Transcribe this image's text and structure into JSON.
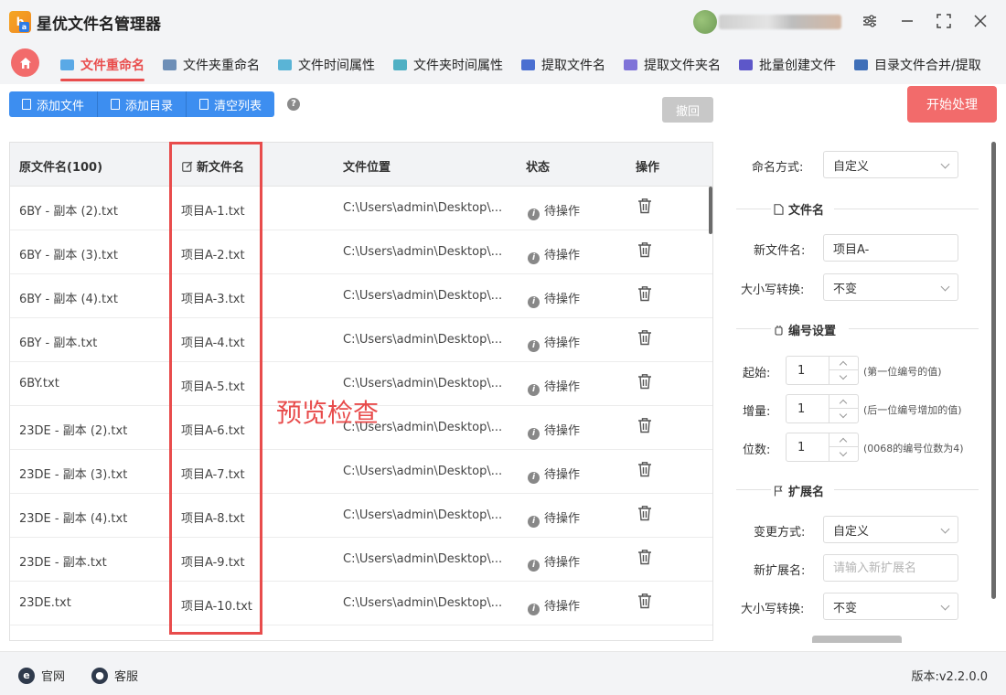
{
  "app": {
    "title": "星优文件名管理器",
    "logo_letter": "b",
    "logo_sub": "a"
  },
  "window_controls": {
    "settings": "⚙",
    "minimize": "—",
    "maximize": "⛶",
    "close": "✕"
  },
  "nav": {
    "tabs": [
      {
        "label": "文件重命名",
        "color": "#5aa9e6"
      },
      {
        "label": "文件夹重命名",
        "color": "#6e8fb7"
      },
      {
        "label": "文件时间属性",
        "color": "#5ab4d6"
      },
      {
        "label": "文件夹时间属性",
        "color": "#4fb0c4"
      },
      {
        "label": "提取文件名",
        "color": "#4a6fd1"
      },
      {
        "label": "提取文件夹名",
        "color": "#7f73d8"
      },
      {
        "label": "批量创建文件",
        "color": "#5d57c9"
      },
      {
        "label": "目录文件合并/提取",
        "color": "#3f6fb8"
      }
    ]
  },
  "toolbar": {
    "add_file": "添加文件",
    "add_dir": "添加目录",
    "clear_list": "清空列表",
    "help": "?",
    "undo": "撤回",
    "start": "开始处理"
  },
  "table": {
    "headers": {
      "original": "原文件名(100)",
      "new_name": "新文件名",
      "location": "文件位置",
      "status": "状态",
      "action": "操作"
    },
    "rows": [
      {
        "original": "6BY - 副本 (2).txt",
        "new_name": "项目A-1.txt",
        "location": "C:\\Users\\admin\\Desktop\\...",
        "status": "待操作"
      },
      {
        "original": "6BY - 副本 (3).txt",
        "new_name": "项目A-2.txt",
        "location": "C:\\Users\\admin\\Desktop\\...",
        "status": "待操作"
      },
      {
        "original": "6BY - 副本 (4).txt",
        "new_name": "项目A-3.txt",
        "location": "C:\\Users\\admin\\Desktop\\...",
        "status": "待操作"
      },
      {
        "original": "6BY - 副本.txt",
        "new_name": "项目A-4.txt",
        "location": "C:\\Users\\admin\\Desktop\\...",
        "status": "待操作"
      },
      {
        "original": "6BY.txt",
        "new_name": "项目A-5.txt",
        "location": "C:\\Users\\admin\\Desktop\\...",
        "status": "待操作"
      },
      {
        "original": "23DE - 副本 (2).txt",
        "new_name": "项目A-6.txt",
        "location": "C:\\Users\\admin\\Desktop\\...",
        "status": "待操作"
      },
      {
        "original": "23DE - 副本 (3).txt",
        "new_name": "项目A-7.txt",
        "location": "C:\\Users\\admin\\Desktop\\...",
        "status": "待操作"
      },
      {
        "original": "23DE - 副本 (4).txt",
        "new_name": "项目A-8.txt",
        "location": "C:\\Users\\admin\\Desktop\\...",
        "status": "待操作"
      },
      {
        "original": "23DE - 副本.txt",
        "new_name": "项目A-9.txt",
        "location": "C:\\Users\\admin\\Desktop\\...",
        "status": "待操作"
      },
      {
        "original": "23DE.txt",
        "new_name": "项目A-10.txt",
        "location": "C:\\Users\\admin\\Desktop\\...",
        "status": "待操作"
      }
    ],
    "preview_label": "预览检查"
  },
  "settings": {
    "naming_mode": {
      "label": "命名方式:",
      "value": "自定义"
    },
    "filename_section": "文件名",
    "new_filename": {
      "label": "新文件名:",
      "value": "项目A-"
    },
    "case_convert": {
      "label": "大小写转换:",
      "value": "不变"
    },
    "numbering_section": "编号设置",
    "start": {
      "label": "起始:",
      "value": "1",
      "hint": "(第一位编号的值)"
    },
    "increment": {
      "label": "增量:",
      "value": "1",
      "hint": "(后一位编号增加的值)"
    },
    "digits": {
      "label": "位数:",
      "value": "1",
      "hint": "(0068的编号位数为4)"
    },
    "extension_section": "扩展名",
    "change_mode": {
      "label": "变更方式:",
      "value": "自定义"
    },
    "new_extension": {
      "label": "新扩展名:",
      "placeholder": "请输入新扩展名"
    },
    "ext_case_convert": {
      "label": "大小写转换:",
      "value": "不变"
    }
  },
  "footer": {
    "official_site": "官网",
    "support": "客服",
    "version": "版本:v2.2.0.0"
  },
  "colors": {
    "accent_red": "#f26b6b",
    "toolbar_blue": "#3d8ef0",
    "highlight_red": "#e84c4c"
  }
}
